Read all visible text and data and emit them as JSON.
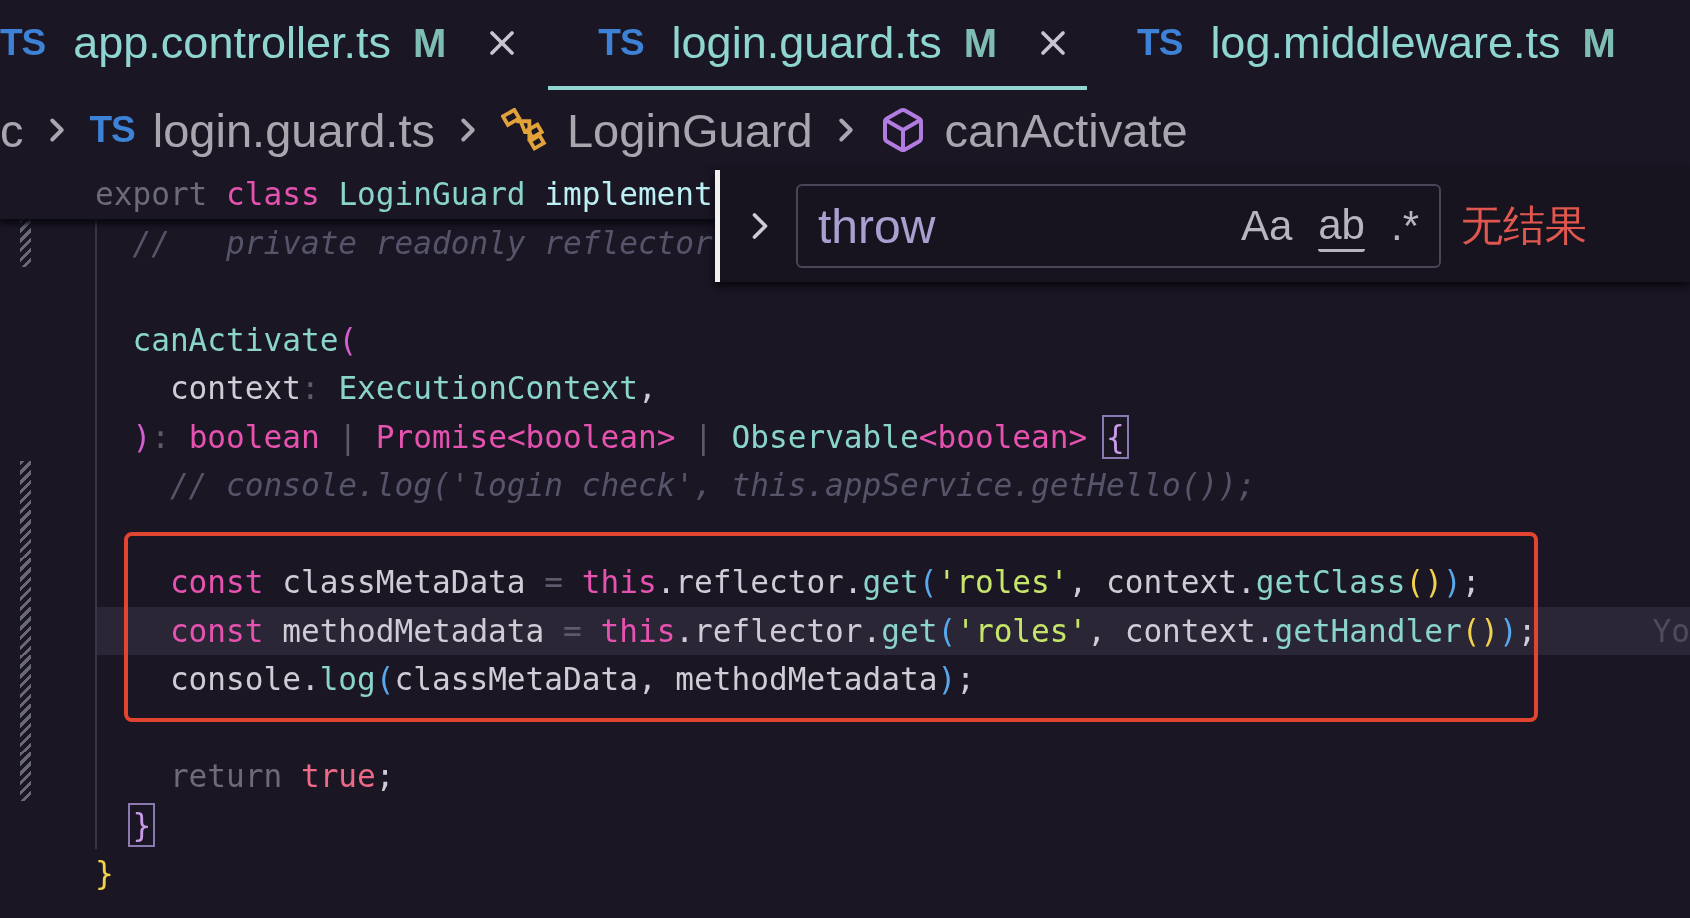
{
  "tabs": [
    {
      "lang": "TS",
      "label": "app.controller.ts",
      "status": "M",
      "selected": false,
      "closable": true
    },
    {
      "lang": "TS",
      "label": "login.guard.ts",
      "status": "M",
      "selected": true,
      "closable": true
    },
    {
      "lang": "TS",
      "label": "log.middleware.ts",
      "status": "M",
      "selected": false,
      "closable": false
    }
  ],
  "breadcrumbs": [
    {
      "kind": "folder",
      "label": "c"
    },
    {
      "kind": "file",
      "lang": "TS",
      "label": "login.guard.ts"
    },
    {
      "kind": "class",
      "label": "LoginGuard"
    },
    {
      "kind": "method",
      "label": "canActivate"
    }
  ],
  "sticky_line": [
    {
      "t": "export ",
      "kind": "muted"
    },
    {
      "t": "class ",
      "kind": "keyword"
    },
    {
      "t": "LoginGuard ",
      "kind": "function"
    },
    {
      "t": "implement",
      "kind": "property"
    }
  ],
  "lines": [
    {
      "modified": true,
      "tokens": [
        {
          "t": "  //   private readonly reflector",
          "kind": "comment"
        }
      ]
    },
    {
      "gap_above": true,
      "tokens": [
        {
          "t": "  canActivate",
          "kind": "function"
        },
        {
          "t": "(",
          "kind": "bracket1"
        }
      ]
    },
    {
      "tokens": [
        {
          "t": "    context",
          "kind": "identifier"
        },
        {
          "t": ": ",
          "kind": "operator"
        },
        {
          "t": "ExecutionContext",
          "kind": "function"
        },
        {
          "t": ",",
          "kind": "identifier"
        }
      ]
    },
    {
      "tokens": [
        {
          "t": "  )",
          "kind": "bracket1"
        },
        {
          "t": ": ",
          "kind": "operator"
        },
        {
          "t": "boolean ",
          "kind": "keyword"
        },
        {
          "t": "| ",
          "kind": "operator"
        },
        {
          "t": "Promise<boolean> ",
          "kind": "keyword"
        },
        {
          "t": "| ",
          "kind": "operator"
        },
        {
          "t": "Observable",
          "kind": "function"
        },
        {
          "t": "<boolean> ",
          "kind": "keyword"
        },
        {
          "t": "{",
          "kind": "match"
        }
      ]
    },
    {
      "modified": true,
      "tokens": [
        {
          "t": "    // console.log('login check', this.appService.getHello());",
          "kind": "comment"
        }
      ]
    },
    {
      "modified": true,
      "gap_above": true,
      "boxed": true,
      "tokens": [
        {
          "t": "    const ",
          "kind": "keyword"
        },
        {
          "t": "classMetaData ",
          "kind": "identifier"
        },
        {
          "t": "= ",
          "kind": "operator"
        },
        {
          "t": "this",
          "kind": "keyword"
        },
        {
          "t": ".reflector.",
          "kind": "identifier"
        },
        {
          "t": "get",
          "kind": "function"
        },
        {
          "t": "(",
          "kind": "bracket2"
        },
        {
          "t": "'roles'",
          "kind": "string"
        },
        {
          "t": ", context.",
          "kind": "identifier"
        },
        {
          "t": "getClass",
          "kind": "function"
        },
        {
          "t": "()",
          "kind": "bracket3"
        },
        {
          "t": ")",
          "kind": "bracket2"
        },
        {
          "t": ";",
          "kind": "identifier"
        }
      ]
    },
    {
      "modified": true,
      "boxed": true,
      "current": true,
      "blame": "Yo",
      "tokens": [
        {
          "t": "    const ",
          "kind": "keyword"
        },
        {
          "t": "methodMetadata ",
          "kind": "identifier"
        },
        {
          "t": "= ",
          "kind": "operator"
        },
        {
          "t": "this",
          "kind": "keyword"
        },
        {
          "t": ".reflector.",
          "kind": "identifier"
        },
        {
          "t": "get",
          "kind": "function"
        },
        {
          "t": "(",
          "kind": "bracket2"
        },
        {
          "t": "'roles'",
          "kind": "string"
        },
        {
          "t": ", context.",
          "kind": "identifier"
        },
        {
          "t": "getHandler",
          "kind": "function"
        },
        {
          "t": "()",
          "kind": "bracket3"
        },
        {
          "t": ")",
          "kind": "bracket2"
        },
        {
          "t": ";",
          "kind": "identifier"
        }
      ]
    },
    {
      "modified": true,
      "boxed": true,
      "tokens": [
        {
          "t": "    console.",
          "kind": "identifier"
        },
        {
          "t": "log",
          "kind": "function"
        },
        {
          "t": "(",
          "kind": "bracket2"
        },
        {
          "t": "classMetaData, methodMetadata",
          "kind": "identifier"
        },
        {
          "t": ")",
          "kind": "bracket2"
        },
        {
          "t": ";",
          "kind": "identifier"
        }
      ]
    },
    {
      "modified": true,
      "gap_above": true,
      "tokens": [
        {
          "t": "    return ",
          "kind": "muted"
        },
        {
          "t": "true",
          "kind": "literal"
        },
        {
          "t": ";",
          "kind": "identifier"
        }
      ]
    },
    {
      "tokens": [
        {
          "t": "  }",
          "kind": "match"
        }
      ]
    },
    {
      "tokens": [
        {
          "t": "}",
          "kind": "bracket3"
        }
      ]
    }
  ],
  "find": {
    "value": "throw",
    "options": [
      {
        "label": "Aa",
        "kind": "plain"
      },
      {
        "label": "ab",
        "kind": "underlined"
      },
      {
        "label": ".*",
        "kind": "plain"
      }
    ],
    "result": "无结果"
  }
}
